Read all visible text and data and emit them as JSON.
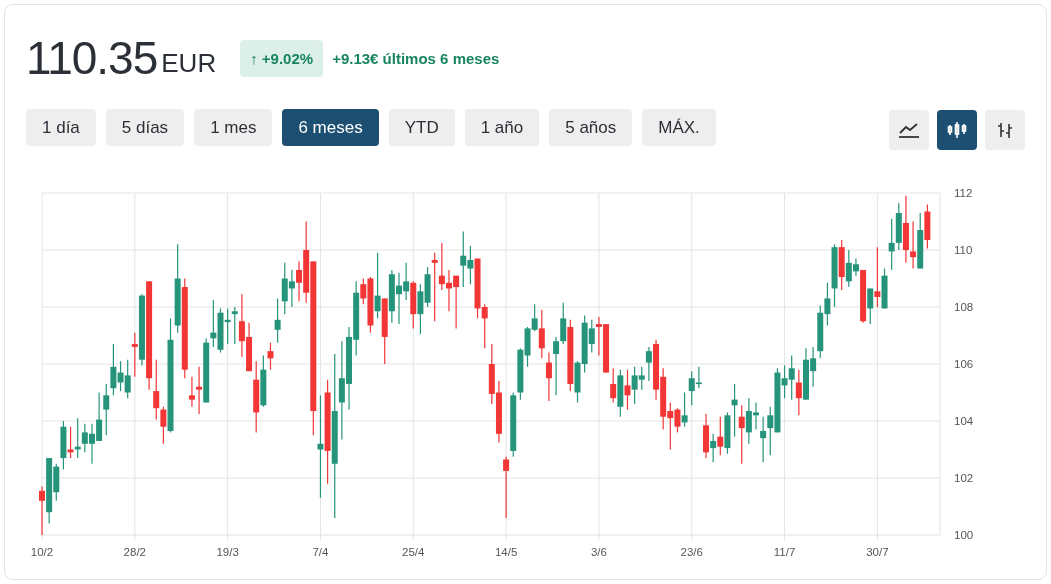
{
  "price": "110.35",
  "currency": "EUR",
  "change_badge": {
    "arrow": "↑",
    "text": "+9.02%"
  },
  "change_text": "+9.13€ últimos 6 meses",
  "ranges": [
    {
      "label": "1 día",
      "selected": false
    },
    {
      "label": "5 días",
      "selected": false
    },
    {
      "label": "1 mes",
      "selected": false
    },
    {
      "label": "6 meses",
      "selected": true
    },
    {
      "label": "YTD",
      "selected": false
    },
    {
      "label": "1 año",
      "selected": false
    },
    {
      "label": "5 años",
      "selected": false
    },
    {
      "label": "MÁX.",
      "selected": false
    }
  ],
  "chart_types": [
    {
      "kind": "line",
      "selected": false
    },
    {
      "kind": "candlestick",
      "selected": true
    },
    {
      "kind": "ohlc",
      "selected": false
    }
  ],
  "chart_data": {
    "type": "candlestick",
    "grid": true,
    "ylim": [
      100,
      112
    ],
    "yticks": [
      100,
      102,
      104,
      106,
      108,
      110,
      112
    ],
    "categories": [
      "10/2",
      null,
      null,
      null,
      null,
      null,
      null,
      null,
      null,
      null,
      null,
      null,
      null,
      "28/2",
      null,
      null,
      null,
      null,
      null,
      null,
      null,
      null,
      null,
      null,
      null,
      null,
      "19/3",
      null,
      null,
      null,
      null,
      null,
      null,
      null,
      null,
      null,
      null,
      null,
      null,
      "7/4",
      null,
      null,
      null,
      null,
      null,
      null,
      null,
      null,
      null,
      null,
      null,
      null,
      "25/4",
      null,
      null,
      null,
      null,
      null,
      null,
      null,
      null,
      null,
      null,
      null,
      null,
      "14/5",
      null,
      null,
      null,
      null,
      null,
      null,
      null,
      null,
      null,
      null,
      null,
      null,
      "3/6",
      null,
      null,
      null,
      null,
      null,
      null,
      null,
      null,
      null,
      null,
      null,
      null,
      "23/6",
      null,
      null,
      null,
      null,
      null,
      null,
      null,
      null,
      null,
      null,
      null,
      null,
      "11/7",
      null,
      null,
      null,
      null,
      null,
      null,
      null,
      null,
      null,
      null,
      null,
      null,
      "30/7",
      null,
      null,
      null,
      null,
      null,
      null,
      null
    ],
    "ohlc": [
      [
        101.55,
        101.7,
        100.0,
        101.2
      ],
      [
        100.8,
        102.7,
        100.4,
        102.7
      ],
      [
        101.5,
        102.5,
        101.2,
        102.4
      ],
      [
        102.7,
        104.0,
        102.3,
        103.8
      ],
      [
        103.0,
        103.8,
        102.7,
        102.9
      ],
      [
        103.0,
        104.1,
        102.7,
        103.1
      ],
      [
        103.2,
        103.9,
        102.9,
        103.6
      ],
      [
        103.2,
        103.9,
        102.5,
        103.55
      ],
      [
        103.3,
        105.0,
        103.3,
        104.05
      ],
      [
        104.4,
        105.3,
        103.5,
        104.9
      ],
      [
        105.15,
        106.7,
        104.9,
        105.9
      ],
      [
        105.35,
        106.1,
        105.05,
        105.7
      ],
      [
        105.0,
        106.15,
        104.8,
        105.6
      ],
      [
        106.7,
        107.1,
        105.55,
        106.6
      ],
      [
        106.15,
        108.45,
        105.95,
        108.4
      ],
      [
        108.9,
        108.9,
        105.1,
        105.5
      ],
      [
        105.05,
        106.15,
        104.05,
        104.45
      ],
      [
        104.4,
        104.5,
        103.2,
        103.8
      ],
      [
        103.65,
        107.6,
        103.6,
        106.85
      ],
      [
        107.35,
        110.2,
        107.1,
        109.0
      ],
      [
        108.7,
        109.0,
        105.5,
        105.8
      ],
      [
        104.9,
        105.55,
        104.5,
        104.75
      ],
      [
        105.2,
        105.9,
        104.25,
        105.1
      ],
      [
        104.65,
        106.9,
        104.65,
        106.75
      ],
      [
        106.9,
        108.25,
        106.6,
        107.1
      ],
      [
        106.5,
        107.95,
        106.4,
        107.8
      ],
      [
        107.47,
        107.95,
        106.7,
        107.55
      ],
      [
        107.75,
        108.0,
        106.7,
        107.85
      ],
      [
        107.5,
        108.45,
        106.25,
        106.8
      ],
      [
        106.95,
        107.45,
        105.75,
        105.75
      ],
      [
        105.45,
        106.1,
        103.6,
        104.3
      ],
      [
        104.55,
        106.3,
        104.5,
        105.8
      ],
      [
        106.45,
        106.75,
        105.8,
        106.2
      ],
      [
        107.2,
        108.3,
        106.75,
        107.55
      ],
      [
        108.2,
        109.55,
        107.75,
        109.0
      ],
      [
        108.65,
        109.3,
        108.0,
        108.9
      ],
      [
        109.3,
        109.6,
        108.2,
        108.85
      ],
      [
        110.0,
        111.0,
        108.15,
        108.5
      ],
      [
        109.6,
        109.6,
        103.5,
        104.35
      ],
      [
        103.0,
        104.9,
        101.3,
        103.2
      ],
      [
        105.0,
        105.45,
        101.8,
        102.95
      ],
      [
        102.5,
        106.35,
        100.6,
        104.35
      ],
      [
        104.65,
        106.8,
        103.35,
        105.5
      ],
      [
        105.3,
        107.3,
        104.4,
        106.95
      ],
      [
        106.85,
        108.9,
        106.3,
        108.5
      ],
      [
        108.8,
        109.0,
        108.1,
        108.3
      ],
      [
        109.0,
        109.05,
        107.1,
        107.35
      ],
      [
        107.85,
        109.9,
        107.6,
        108.4
      ],
      [
        108.3,
        108.3,
        106.0,
        106.95
      ],
      [
        107.85,
        109.3,
        107.45,
        109.15
      ],
      [
        108.45,
        109.2,
        107.4,
        108.75
      ],
      [
        108.55,
        109.55,
        108.25,
        108.9
      ],
      [
        108.85,
        108.9,
        107.25,
        107.75
      ],
      [
        107.75,
        108.8,
        107.05,
        108.55
      ],
      [
        108.15,
        109.4,
        108.0,
        109.15
      ],
      [
        109.65,
        109.9,
        107.5,
        109.55
      ],
      [
        109.1,
        110.25,
        108.6,
        108.8
      ],
      [
        108.85,
        109.3,
        107.85,
        108.65
      ],
      [
        109.1,
        109.1,
        107.25,
        108.7
      ],
      [
        109.45,
        110.65,
        108.7,
        109.8
      ],
      [
        109.35,
        110.15,
        108.8,
        109.65
      ],
      [
        109.7,
        109.7,
        107.6,
        107.95
      ],
      [
        108.0,
        108.1,
        106.55,
        107.6
      ],
      [
        106.0,
        106.7,
        104.6,
        104.95
      ],
      [
        105.0,
        105.4,
        103.25,
        103.55
      ],
      [
        102.65,
        102.75,
        100.6,
        102.25
      ],
      [
        102.95,
        105.0,
        102.75,
        104.9
      ],
      [
        105.0,
        106.55,
        104.75,
        106.5
      ],
      [
        106.3,
        107.3,
        105.9,
        107.25
      ],
      [
        107.2,
        108.1,
        107.15,
        107.6
      ],
      [
        107.25,
        107.9,
        106.2,
        106.55
      ],
      [
        106.05,
        106.4,
        104.7,
        105.5
      ],
      [
        106.35,
        106.95,
        104.9,
        106.8
      ],
      [
        106.8,
        108.15,
        106.7,
        107.6
      ],
      [
        107.3,
        107.55,
        105.05,
        105.3
      ],
      [
        105.0,
        106.1,
        104.65,
        106.05
      ],
      [
        106.0,
        107.7,
        105.7,
        107.45
      ],
      [
        106.7,
        107.55,
        106.4,
        107.25
      ],
      [
        107.4,
        107.65,
        106.3,
        107.3
      ],
      [
        107.4,
        107.4,
        105.7,
        105.7
      ],
      [
        105.3,
        105.85,
        104.65,
        104.8
      ],
      [
        104.5,
        105.8,
        104.15,
        105.6
      ],
      [
        105.25,
        105.8,
        104.4,
        104.9
      ],
      [
        105.1,
        105.9,
        104.6,
        105.6
      ],
      [
        105.45,
        105.9,
        105.1,
        105.6
      ],
      [
        106.05,
        106.6,
        105.4,
        106.45
      ],
      [
        106.7,
        106.85,
        104.75,
        105.1
      ],
      [
        105.55,
        105.85,
        103.7,
        104.15
      ],
      [
        104.35,
        104.65,
        103.0,
        104.1
      ],
      [
        104.4,
        104.45,
        103.6,
        103.8
      ],
      [
        103.95,
        105.0,
        103.8,
        104.2
      ],
      [
        105.05,
        105.75,
        104.55,
        105.5
      ],
      [
        105.3,
        105.9,
        105.15,
        105.35
      ],
      [
        103.85,
        104.25,
        102.7,
        102.9
      ],
      [
        103.05,
        103.55,
        102.55,
        103.3
      ],
      [
        103.45,
        104.15,
        102.8,
        103.1
      ],
      [
        103.05,
        104.3,
        102.85,
        104.2
      ],
      [
        104.55,
        105.3,
        103.45,
        104.75
      ],
      [
        104.15,
        104.55,
        102.5,
        103.75
      ],
      [
        103.6,
        104.8,
        103.2,
        104.35
      ],
      [
        104.2,
        104.65,
        103.7,
        104.3
      ],
      [
        103.4,
        104.15,
        102.55,
        103.65
      ],
      [
        103.75,
        104.5,
        102.8,
        104.2
      ],
      [
        103.6,
        105.85,
        103.6,
        105.7
      ],
      [
        105.25,
        105.95,
        104.8,
        105.5
      ],
      [
        105.45,
        106.3,
        104.75,
        105.85
      ],
      [
        105.35,
        105.8,
        104.2,
        104.8
      ],
      [
        104.75,
        106.55,
        104.75,
        106.15
      ],
      [
        105.75,
        106.6,
        105.2,
        106.2
      ],
      [
        106.45,
        108.05,
        106.2,
        107.8
      ],
      [
        107.75,
        108.85,
        107.35,
        108.3
      ],
      [
        108.65,
        110.2,
        108.0,
        110.1
      ],
      [
        110.1,
        110.35,
        108.6,
        109.05
      ],
      [
        108.9,
        110.0,
        108.7,
        109.55
      ],
      [
        109.25,
        109.7,
        109.1,
        109.5
      ],
      [
        109.3,
        109.3,
        107.45,
        107.5
      ],
      [
        107.95,
        108.65,
        107.4,
        108.65
      ],
      [
        108.55,
        110.1,
        108.0,
        108.35
      ],
      [
        107.95,
        109.35,
        107.95,
        109.1
      ],
      [
        109.95,
        111.1,
        109.3,
        110.25
      ],
      [
        110.25,
        111.65,
        110.0,
        111.3
      ],
      [
        110.95,
        111.9,
        109.55,
        110.0
      ],
      [
        109.95,
        111.0,
        109.35,
        109.75
      ],
      [
        109.35,
        111.3,
        109.35,
        110.7
      ],
      [
        111.35,
        111.6,
        110.05,
        110.35
      ]
    ]
  }
}
